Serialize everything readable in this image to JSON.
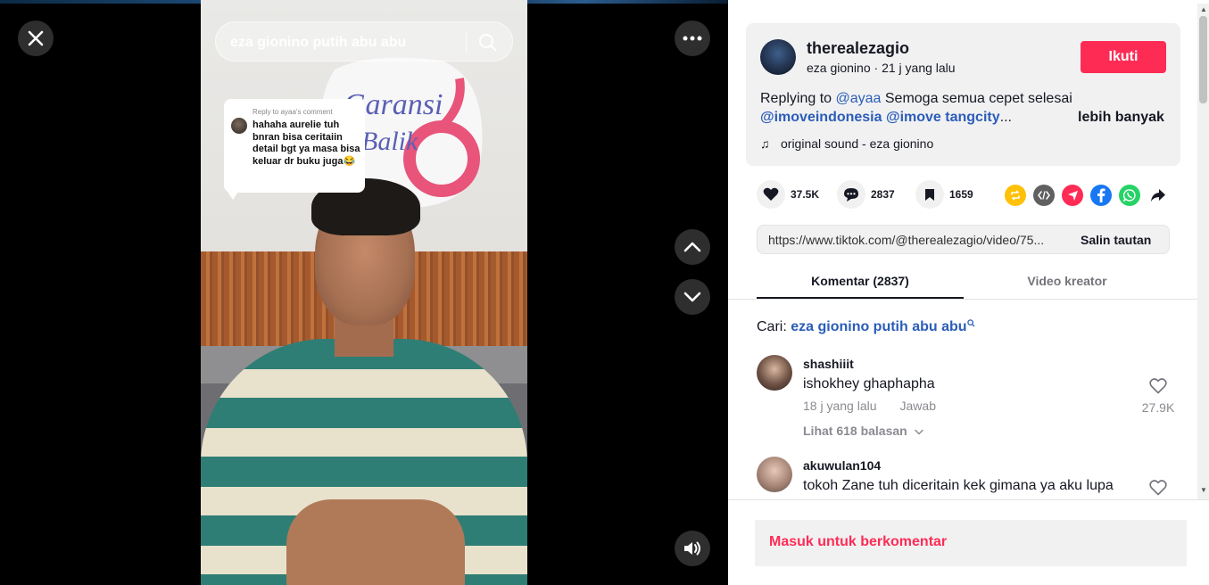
{
  "video": {
    "search_query": "eza gionino putih abu abu",
    "reply_bubble": {
      "header": "Reply to ayaa's comment",
      "text": "hahaha aurelie tuh bnran bisa ceritaiin detail bgt ya masa bisa keluar dr buku juga😂"
    },
    "controls": {
      "close_icon": "close-icon",
      "more_icon": "ellipsis-icon",
      "prev_icon": "chevron-up-icon",
      "next_icon": "chevron-down-icon",
      "volume_icon": "volume-icon"
    }
  },
  "post": {
    "username": "therealezagio",
    "display_name": "eza gionino",
    "time_ago": "21 j yang lalu",
    "meta_separator": " · ",
    "follow_label": "Ikuti",
    "desc": {
      "prefix": "Replying to ",
      "mention1": "@ayaa",
      "text1": " Semoga semua cepet selesai",
      "mention2": "@imoveindonesia",
      "mention3": "@imove tangcity",
      "ellipsis": "...",
      "more_label": "lebih banyak"
    },
    "music": "original sound - eza gionino"
  },
  "actions": {
    "likes": "37.5K",
    "comments": "2837",
    "saves": "1659"
  },
  "share": [
    "repost-icon",
    "embed-icon",
    "send-to-friends-icon",
    "facebook-icon",
    "whatsapp-icon",
    "share-arrow-icon"
  ],
  "link": {
    "url": "https://www.tiktok.com/@therealezagio/video/75...",
    "copy_label": "Salin tautan"
  },
  "tabs": {
    "comments": "Komentar (2837)",
    "creator_videos": "Video kreator"
  },
  "search_suggest": {
    "prefix": "Cari: ",
    "query": "eza gionino putih abu abu"
  },
  "comments": [
    {
      "username": "shashiiit",
      "text": "ishokhey ghaphapha",
      "time": "18 j yang lalu",
      "reply_label": "Jawab",
      "likes": "27.9K",
      "view_replies": "Lihat 618 balasan"
    },
    {
      "username": "akuwulan104",
      "text": "tokoh Zane tuh diceritain kek gimana ya aku lupa"
    }
  ],
  "footer": {
    "login_comment": "Masuk untuk berkomentar"
  },
  "colors": {
    "accent": "#fe2c55",
    "mention": "#2b5db9",
    "card_bg": "#f1f1f2"
  }
}
